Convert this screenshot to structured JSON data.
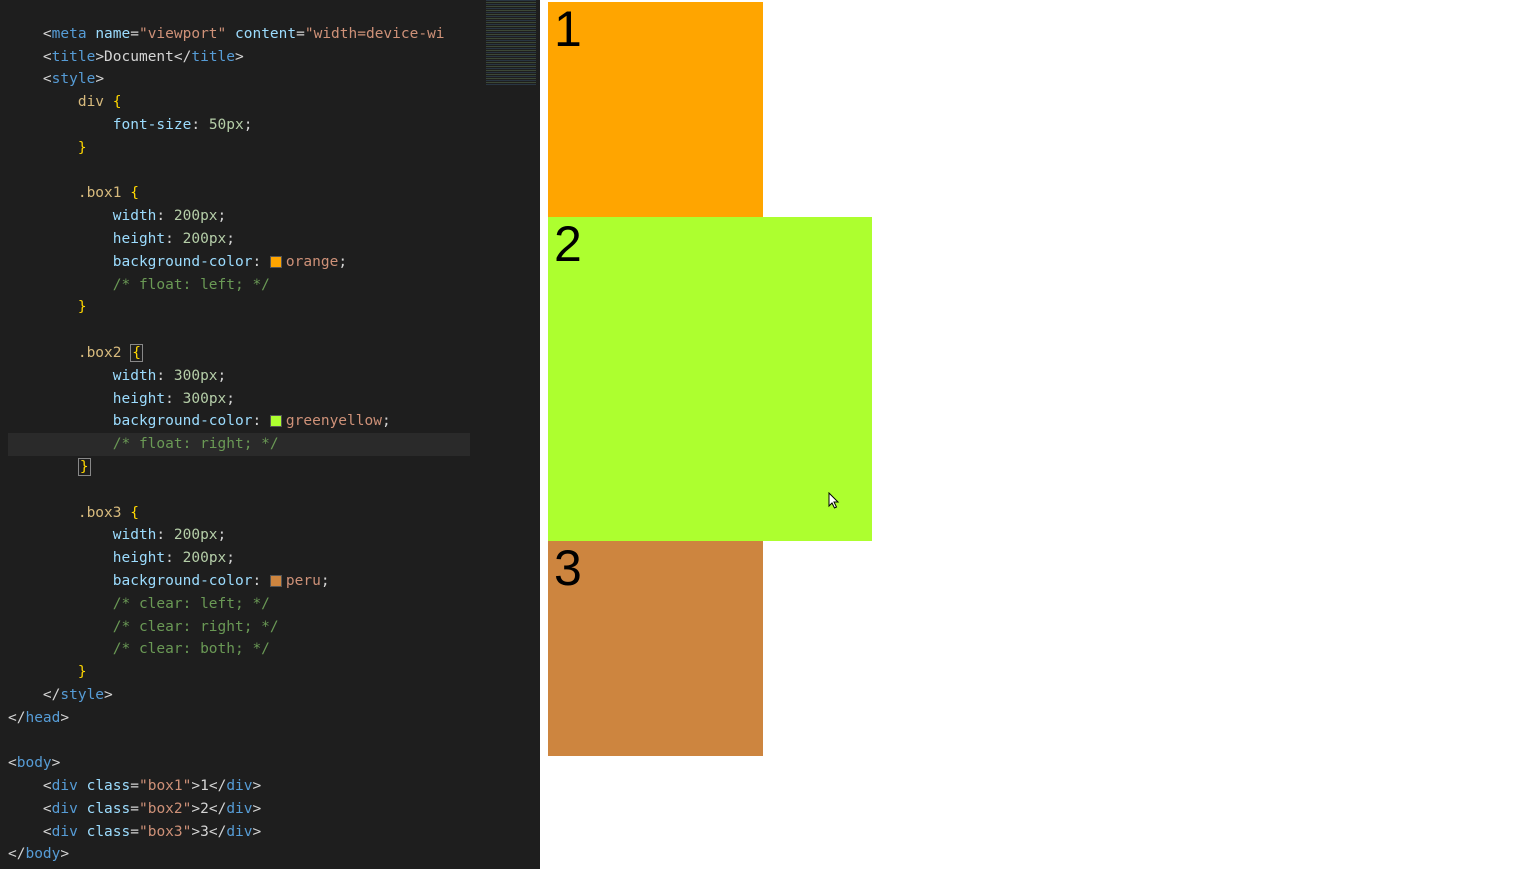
{
  "editor": {
    "lines": {
      "l1": "    <meta name=\"viewport\" content=\"width=device-wi",
      "title_open": "title",
      "title_text": "Document",
      "title_close": "title",
      "style_open": "style",
      "sel_div": "div",
      "prop_fontsize": "font-size",
      "val_50px": "50px",
      "sel_box1": ".box1",
      "prop_width": "width",
      "val_200px": "200px",
      "prop_height": "height",
      "prop_bgcolor": "background-color",
      "val_orange": "orange",
      "comment_fl": "/* float: left; */",
      "sel_box2": ".box2",
      "val_300px": "300px",
      "val_gy": "greenyellow",
      "comment_fr": "/* float: right; */",
      "sel_box3": ".box3",
      "val_peru": "peru",
      "comment_cl": "/* clear: left; */",
      "comment_cr": "/* clear: right; */",
      "comment_cb": "/* clear: both; */",
      "style_close": "style",
      "head_close": "head",
      "body_open": "body",
      "div_tag": "div",
      "class_attr": "class",
      "class_box1": "\"box1\"",
      "class_box2": "\"box2\"",
      "class_box3": "\"box3\"",
      "divtext1": "1",
      "divtext2": "2",
      "divtext3": "3",
      "body_close": "body"
    }
  },
  "preview": {
    "box1_text": "1",
    "box2_text": "2",
    "box3_text": "3"
  },
  "colors": {
    "orange": "#ffa500",
    "greenyellow": "#adff2f",
    "peru": "#cd853f"
  }
}
